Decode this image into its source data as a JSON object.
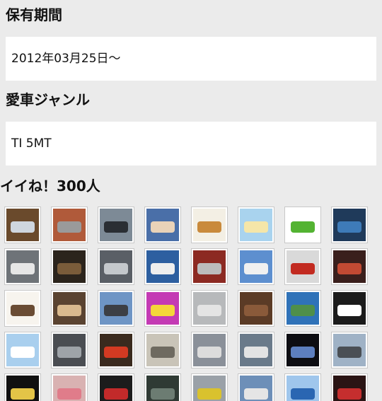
{
  "ownership": {
    "heading": "保有期間",
    "value": "2012年03月25日〜"
  },
  "genre": {
    "heading": "愛車ジャンル",
    "value": "TI 5MT"
  },
  "likes": {
    "heading": "イイね！300人",
    "rows": [
      [
        {
          "name": "avatar-car-front",
          "bg": "#6a4a2c",
          "fg": "#cfd6de"
        },
        {
          "name": "avatar-garage-car",
          "bg": "#b05a3a",
          "fg": "#9a9a9a"
        },
        {
          "name": "avatar-steering-wheel",
          "bg": "#7d8a96",
          "fg": "#2a2e33"
        },
        {
          "name": "avatar-anime-character",
          "bg": "#4a6fa8",
          "fg": "#e9d2b8"
        },
        {
          "name": "avatar-cartoon-bear",
          "bg": "#f3efe4",
          "fg": "#c98a3c"
        },
        {
          "name": "avatar-anime-girl",
          "bg": "#a9d3ee",
          "fg": "#f5e6a8"
        },
        {
          "name": "avatar-clover",
          "bg": "#ffffff",
          "fg": "#53b332"
        },
        {
          "name": "avatar-robot",
          "bg": "#1f3a5a",
          "fg": "#3e7bb8"
        }
      ],
      [
        {
          "name": "avatar-white-car",
          "bg": "#6e7378",
          "fg": "#e6e6e6"
        },
        {
          "name": "avatar-dark-car-night",
          "bg": "#2b241c",
          "fg": "#7a5c3a"
        },
        {
          "name": "avatar-silver-car",
          "bg": "#5a5f66",
          "fg": "#c4c8cc"
        },
        {
          "name": "avatar-white-car-sky",
          "bg": "#2d5fa0",
          "fg": "#eeeeee"
        },
        {
          "name": "avatar-red-car-closeup",
          "bg": "#8c2a22",
          "fg": "#bcbcbc"
        },
        {
          "name": "avatar-white-car-sky-2",
          "bg": "#5d8fcf",
          "fg": "#f0f0f0"
        },
        {
          "name": "avatar-red-car-side",
          "bg": "#d9d9d9",
          "fg": "#c22a20"
        },
        {
          "name": "avatar-car-rear-lights",
          "bg": "#3a1f1c",
          "fg": "#c24a33"
        }
      ],
      [
        {
          "name": "avatar-sketch-face",
          "bg": "#f7f4ee",
          "fg": "#6a4c34"
        },
        {
          "name": "avatar-dog",
          "bg": "#5a4331",
          "fg": "#d9b98e"
        },
        {
          "name": "avatar-car-street",
          "bg": "#6e95c5",
          "fg": "#3c3f45"
        },
        {
          "name": "avatar-colorful-pattern",
          "bg": "#c43ab4",
          "fg": "#f4d63a"
        },
        {
          "name": "avatar-silver-car-2",
          "bg": "#b7b9bb",
          "fg": "#e4e4e4"
        },
        {
          "name": "avatar-wood-texture",
          "bg": "#5b3b26",
          "fg": "#8a5a3a"
        },
        {
          "name": "avatar-island-sea",
          "bg": "#2f72b8",
          "fg": "#4f8f4a"
        },
        {
          "name": "avatar-cartoon-cat",
          "bg": "#1b1b1b",
          "fg": "#ffffff"
        }
      ],
      [
        {
          "name": "avatar-white-ghost",
          "bg": "#a9cfee",
          "fg": "#ffffff"
        },
        {
          "name": "avatar-car-dashboard",
          "bg": "#4a4d52",
          "fg": "#9ea3a8"
        },
        {
          "name": "avatar-red-ball",
          "bg": "#3a2a1e",
          "fg": "#d33a22"
        },
        {
          "name": "avatar-car-interior",
          "bg": "#c9c4b8",
          "fg": "#6e6a60"
        },
        {
          "name": "avatar-car-parking",
          "bg": "#8a9099",
          "fg": "#dcdcdc"
        },
        {
          "name": "avatar-car-outdoor",
          "bg": "#6a7a8a",
          "fg": "#e3e3e3"
        },
        {
          "name": "avatar-car-headlights",
          "bg": "#0d0d12",
          "fg": "#5d7fbf"
        },
        {
          "name": "avatar-helicopter",
          "bg": "#9fb2c6",
          "fg": "#4a4f55"
        }
      ],
      [
        {
          "name": "avatar-statue-liberty",
          "bg": "#101010",
          "fg": "#e3c447"
        },
        {
          "name": "avatar-cartoon-pig",
          "bg": "#d9b2b2",
          "fg": "#e07c8a"
        },
        {
          "name": "avatar-red-event-sign",
          "bg": "#1c1c1c",
          "fg": "#c22a2a"
        },
        {
          "name": "avatar-car-interior-dark",
          "bg": "#2f3a34",
          "fg": "#6c7c72"
        },
        {
          "name": "avatar-yellow-car",
          "bg": "#9aa1a8",
          "fg": "#d9c22e"
        },
        {
          "name": "avatar-white-car-road",
          "bg": "#6d8fb8",
          "fg": "#e5e5e5"
        },
        {
          "name": "avatar-blue-sea",
          "bg": "#9fc6ec",
          "fg": "#2a66b2"
        },
        {
          "name": "avatar-red-car-event",
          "bg": "#2a1414",
          "fg": "#c52e2e"
        }
      ]
    ]
  }
}
